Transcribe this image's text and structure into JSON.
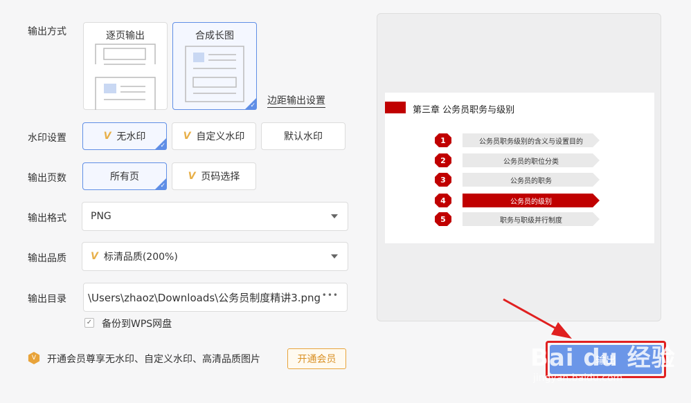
{
  "labels": {
    "output_mode": "输出方式",
    "watermark": "水印设置",
    "pages": "输出页数",
    "format": "输出格式",
    "quality": "输出品质",
    "directory": "输出目录"
  },
  "output_mode": {
    "per_page": "逐页输出",
    "long_image": "合成长图",
    "selected": "合成长图",
    "margin_link": "边距输出设置"
  },
  "watermark": {
    "options": [
      "无水印",
      "自定义水印",
      "默认水印"
    ],
    "selected": "无水印"
  },
  "pages": {
    "options": [
      "所有页",
      "页码选择"
    ],
    "selected": "所有页"
  },
  "format": {
    "value": "PNG"
  },
  "quality": {
    "value": "标清品质(200%)"
  },
  "directory": {
    "value": "\\Users\\zhaoz\\Downloads\\公务员制度精讲3.png",
    "more": "•••"
  },
  "backup": {
    "label": "备份到WPS网盘",
    "checked": true,
    "check_mark": "✓"
  },
  "vip": {
    "icon_glyph": "V",
    "text": "开通会员尊享无水印、自定义水印、高清品质图片",
    "button": "开通会员"
  },
  "export": {
    "label": "输出"
  },
  "preview": {
    "slide_title": "第三章  公务员职务与级别",
    "items": [
      {
        "num": "1",
        "text": "公务员职务级别的含义与设置目的"
      },
      {
        "num": "2",
        "text": "公务员的职位分类"
      },
      {
        "num": "3",
        "text": "公务员的职务"
      },
      {
        "num": "4",
        "text": "公务员的级别"
      },
      {
        "num": "5",
        "text": "职务与职级并行制度"
      }
    ],
    "active_item": 3,
    "accent": "#c00000"
  },
  "watermark_overlay": {
    "brand": "Bai du 经验",
    "url": "jingyan.baidu.com"
  },
  "colors": {
    "selected_border": "#5f8ee6",
    "vip": "#e8a33a",
    "export_bg": "#6b96e8",
    "highlight_red": "#e02020"
  }
}
